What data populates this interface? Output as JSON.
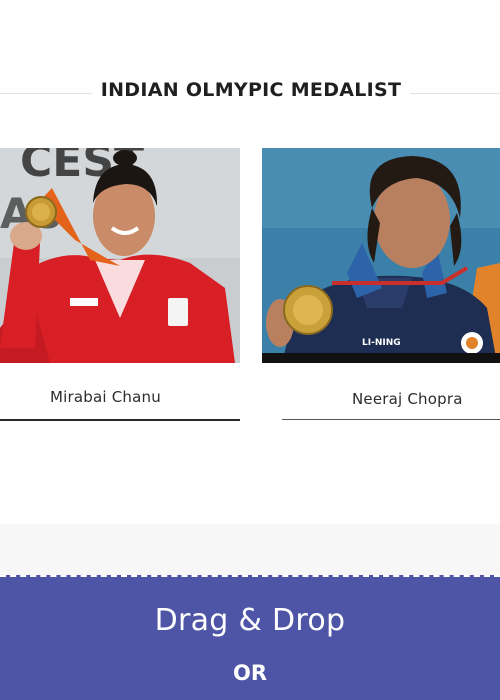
{
  "section": {
    "title": "INDIAN OLMYPIC MEDALIST"
  },
  "medalists": [
    {
      "name": "Mirabai Chanu"
    },
    {
      "name": "Neeraj Chopra"
    }
  ],
  "upload": {
    "title": "Drag & Drop",
    "or_label": "OR"
  },
  "colors": {
    "upload_bg": "#4f55a6",
    "heading": "#1f1f1f"
  }
}
